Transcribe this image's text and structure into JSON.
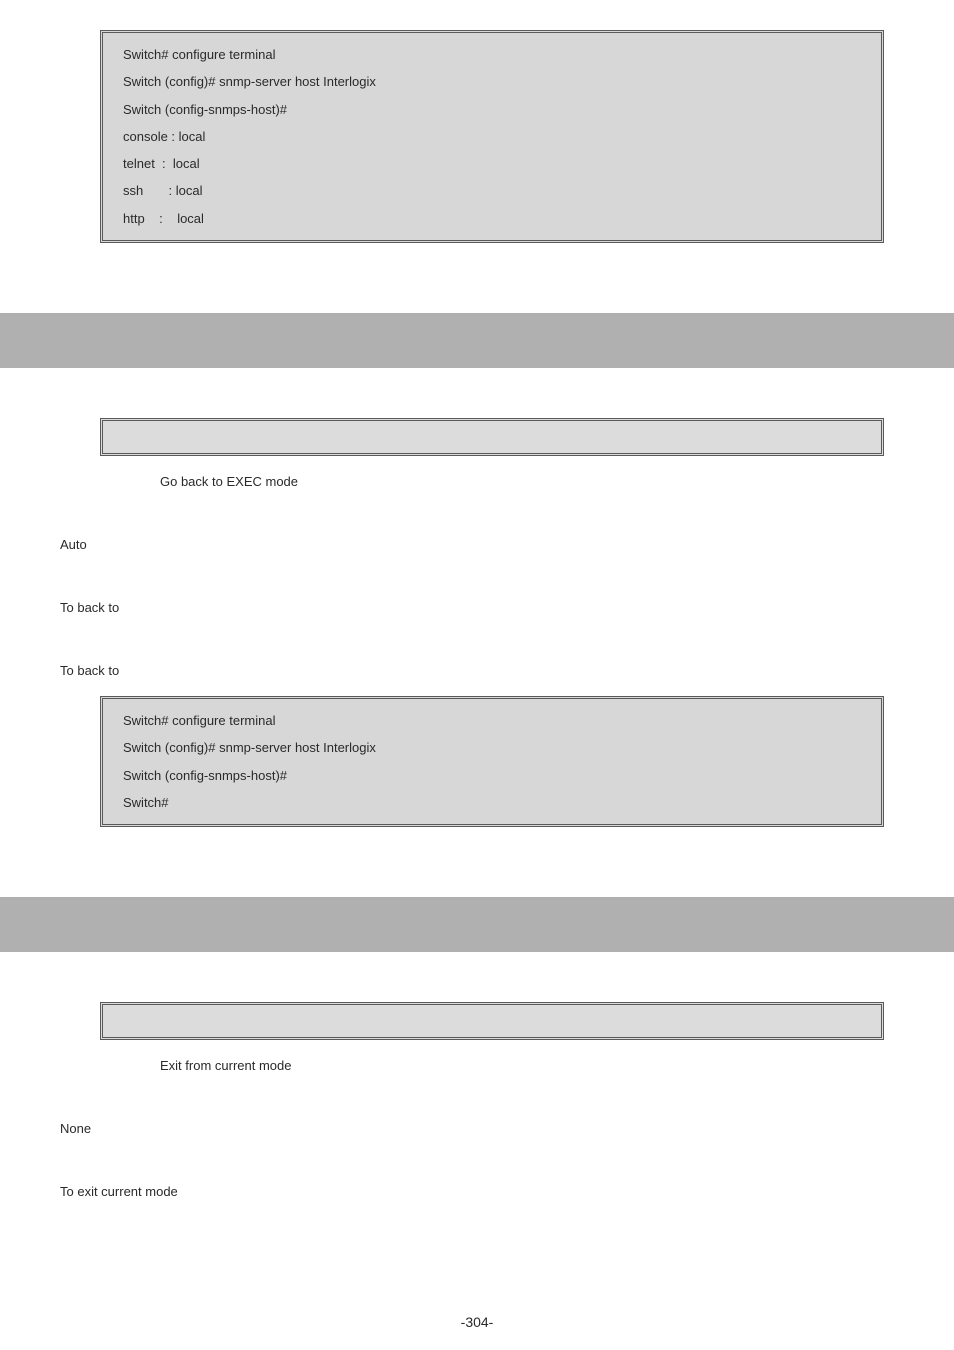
{
  "code1": {
    "l1": "Switch# configure terminal",
    "l2": "Switch (config)# snmp-server host Interlogix",
    "l3": "Switch (config-snmps-host)#",
    "l4": "console : local",
    "l5": "telnet  :  local",
    "l6": "ssh       : local",
    "l7": "http    :    local"
  },
  "section1": {
    "desc": "Go back to EXEC mode",
    "param": "Auto",
    "def": "To back to",
    "usage": "To back to"
  },
  "code2": {
    "l1": "Switch# configure terminal",
    "l2": "Switch (config)# snmp-server host Interlogix",
    "l3": "Switch (config-snmps-host)#",
    "l4": "Switch#"
  },
  "section2": {
    "desc": "Exit from current mode",
    "param": "None",
    "usage": "To exit current mode"
  },
  "pagenum": "-304-"
}
